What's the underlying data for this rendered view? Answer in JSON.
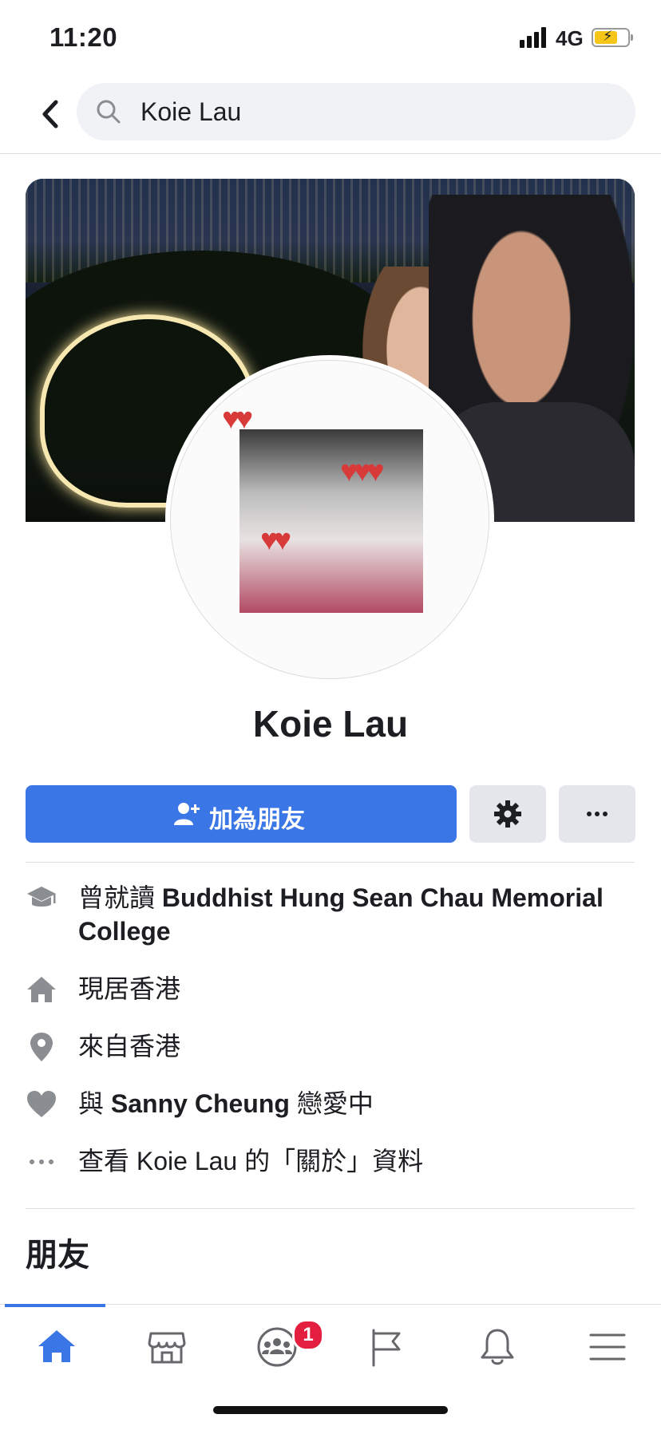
{
  "status_bar": {
    "time": "11:20",
    "network": "4G"
  },
  "search": {
    "query": "Koie Lau"
  },
  "profile": {
    "name": "Koie Lau",
    "add_friend_label": "加為朋友"
  },
  "info": {
    "education_prefix": "曾就讀 ",
    "education_school": "Buddhist Hung Sean Chau Memorial College",
    "lives_in": "現居香港",
    "from": "來自香港",
    "relationship_prefix": "與 ",
    "relationship_partner": "Sanny Cheung",
    "relationship_suffix": " 戀愛中",
    "see_about": "查看 Koie Lau 的「關於」資料"
  },
  "sections": {
    "friends_title": "朋友"
  },
  "tabbar": {
    "icons": [
      "home-icon",
      "marketplace-icon",
      "groups-icon",
      "pages-flag-icon",
      "notifications-bell-icon",
      "menu-icon"
    ],
    "groups_badge": "1",
    "active_color": "#3a76e6",
    "inactive_color": "#65676b"
  },
  "colors": {
    "accent": "#3a76e6",
    "badge": "#e41e3f",
    "grey_button": "#e4e6eb"
  }
}
